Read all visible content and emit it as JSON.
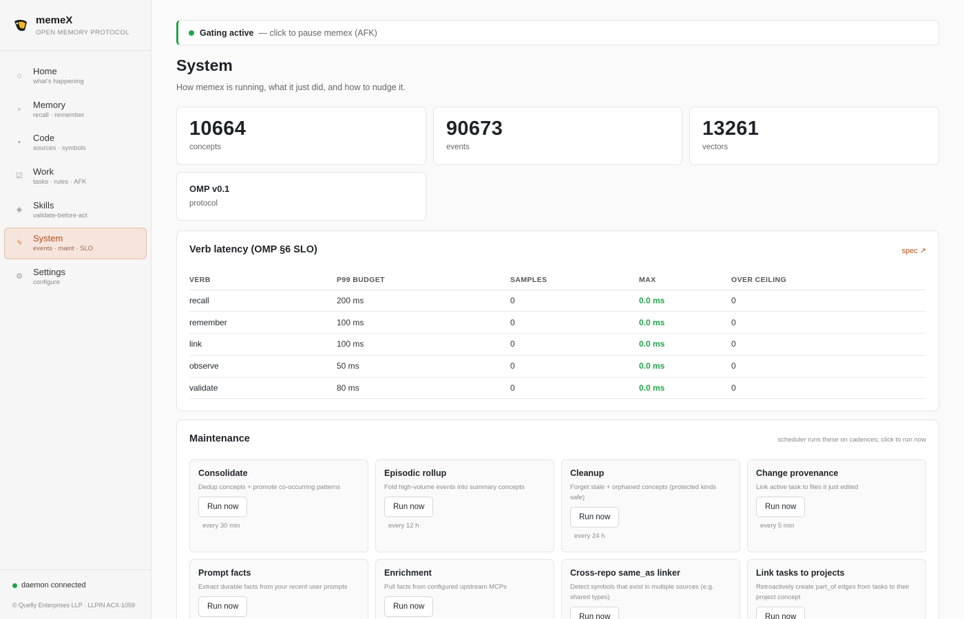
{
  "brand": {
    "name": "memeX",
    "subtitle": "OPEN MEMORY PROTOCOL"
  },
  "nav": [
    {
      "label": "Home",
      "sub": "what's happening",
      "icon": "home-icon",
      "active": false
    },
    {
      "label": "Memory",
      "sub": "recall · remember",
      "icon": "search-icon",
      "active": false
    },
    {
      "label": "Code",
      "sub": "sources · symbols",
      "icon": "dot-icon",
      "active": false
    },
    {
      "label": "Work",
      "sub": "tasks · rules · AFK",
      "icon": "checkbox-icon",
      "active": false
    },
    {
      "label": "Skills",
      "sub": "validate-before-act",
      "icon": "diamond-icon",
      "active": false
    },
    {
      "label": "System",
      "sub": "events · maint · SLO",
      "icon": "lightning-icon",
      "active": true
    },
    {
      "label": "Settings",
      "sub": "configure",
      "icon": "gear-icon",
      "active": false
    }
  ],
  "footer": {
    "status": "daemon connected",
    "copyright": "© Quefly Enterprises LLP · LLPIN ACX-1059"
  },
  "gating": {
    "title": "Gating active",
    "hint": "— click to pause memex (AFK)"
  },
  "page": {
    "title": "System",
    "subtitle": "How memex is running, what it just did, and how to nudge it."
  },
  "stats": [
    {
      "value": "10664",
      "label": "concepts"
    },
    {
      "value": "90673",
      "label": "events"
    },
    {
      "value": "13261",
      "label": "vectors"
    }
  ],
  "protocol": {
    "version": "OMP v0.1",
    "label": "protocol"
  },
  "latency": {
    "title": "Verb latency (OMP §6 SLO)",
    "link": "spec ↗",
    "columns": [
      "VERB",
      "P99 BUDGET",
      "SAMPLES",
      "MAX",
      "OVER CEILING"
    ],
    "rows": [
      [
        "recall",
        "200 ms",
        "0",
        "0.0 ms",
        "0"
      ],
      [
        "remember",
        "100 ms",
        "0",
        "0.0 ms",
        "0"
      ],
      [
        "link",
        "100 ms",
        "0",
        "0.0 ms",
        "0"
      ],
      [
        "observe",
        "50 ms",
        "0",
        "0.0 ms",
        "0"
      ],
      [
        "validate",
        "80 ms",
        "0",
        "0.0 ms",
        "0"
      ]
    ]
  },
  "maintenance": {
    "title": "Maintenance",
    "hint": "scheduler runs these on cadences; click to run now",
    "run_label": "Run now",
    "jobs": [
      {
        "title": "Consolidate",
        "desc": "Dedup concepts + promote co-occurring patterns",
        "cadence": "every 30 min"
      },
      {
        "title": "Episodic rollup",
        "desc": "Fold high-volume events into summary concepts",
        "cadence": "every 12 h"
      },
      {
        "title": "Cleanup",
        "desc": "Forget stale + orphaned concepts (protected kinds safe)",
        "cadence": "every 24 h"
      },
      {
        "title": "Change provenance",
        "desc": "Link active task to files it just edited",
        "cadence": "every 5 min"
      },
      {
        "title": "Prompt facts",
        "desc": "Extract durable facts from your recent user prompts",
        "cadence": ""
      },
      {
        "title": "Enrichment",
        "desc": "Pull facts from configured upstream MCPs",
        "cadence": ""
      },
      {
        "title": "Cross-repo same_as linker",
        "desc": "Detect symbols that exist in multiple sources (e.g. shared types)",
        "cadence": ""
      },
      {
        "title": "Link tasks to projects",
        "desc": "Retroactively create part_of edges from tasks to their project concept",
        "cadence": ""
      }
    ]
  },
  "colors": {
    "accent": "#e5702a",
    "success": "#22a447",
    "active_bg": "#f6e5dc"
  }
}
